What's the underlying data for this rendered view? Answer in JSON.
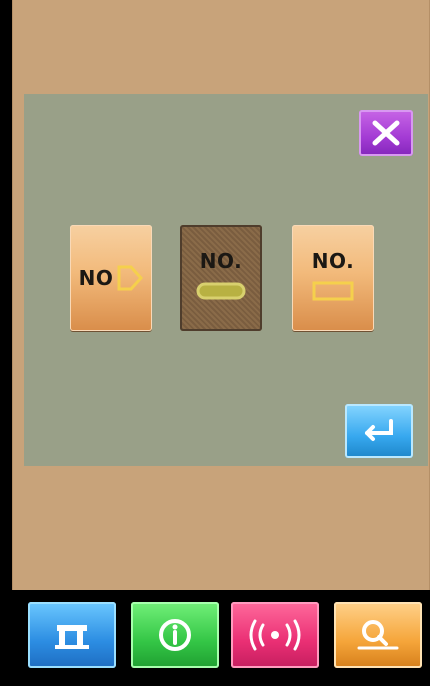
{
  "dialog": {
    "pattern_buttons": [
      {
        "label": "NO",
        "icon": "tag-outline-icon"
      },
      {
        "label": "NO.",
        "icon": "capsule-icon",
        "selected": true
      },
      {
        "label": "NO.",
        "icon": "box-outline-icon"
      }
    ],
    "close_icon": "close-icon",
    "enter_icon": "enter-icon"
  },
  "footer": {
    "buttons": [
      {
        "icon": "sewing-machine-icon",
        "color": "#2c8de2"
      },
      {
        "icon": "info-icon",
        "color": "#34c646"
      },
      {
        "icon": "communication-icon",
        "color": "#ea2f74"
      },
      {
        "icon": "search-icon",
        "color": "#f5a53a"
      }
    ]
  },
  "colors": {
    "frame": "#c8a37a",
    "panel": "#99a088",
    "close": "#a33bd4",
    "enter": "#37a8ef"
  }
}
